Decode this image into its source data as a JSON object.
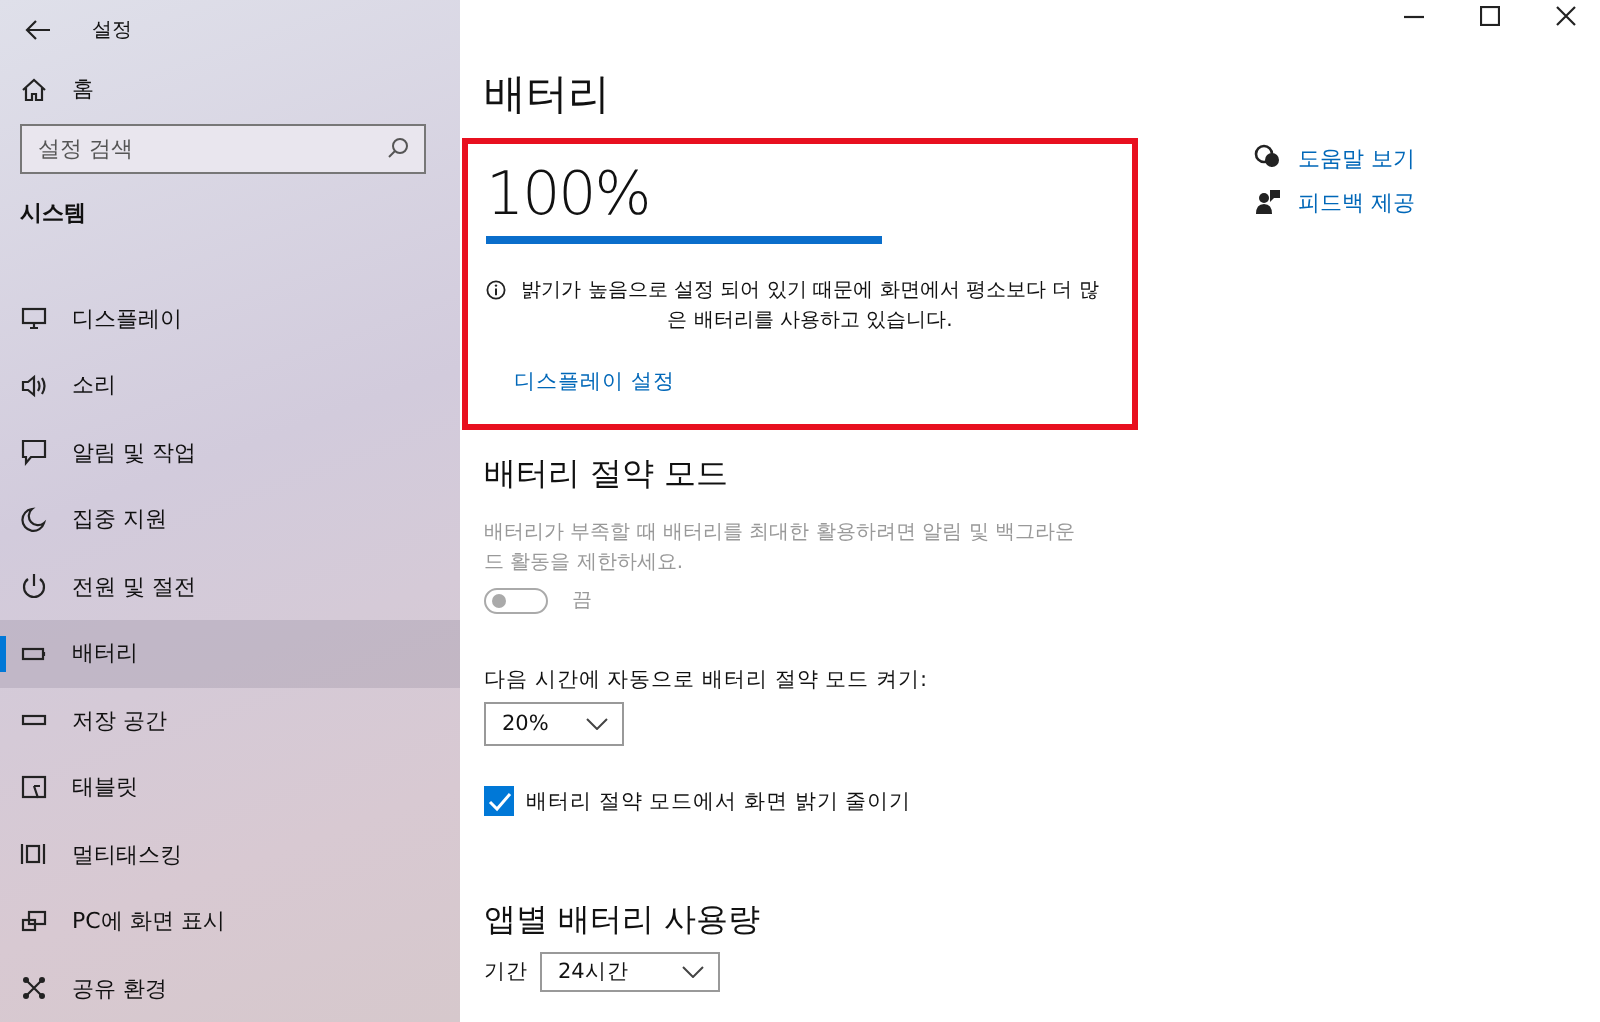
{
  "window": {
    "title": "설정"
  },
  "sidebar": {
    "home": "홈",
    "search": {
      "placeholder": "설정 검색"
    },
    "section": "시스템",
    "items": [
      {
        "label": "디스플레이",
        "selected": false
      },
      {
        "label": "소리",
        "selected": false
      },
      {
        "label": "알림 및 작업",
        "selected": false
      },
      {
        "label": "집중 지원",
        "selected": false
      },
      {
        "label": "전원 및 절전",
        "selected": false
      },
      {
        "label": "배터리",
        "selected": true
      },
      {
        "label": "저장 공간",
        "selected": false
      },
      {
        "label": "태블릿",
        "selected": false
      },
      {
        "label": "멀티태스킹",
        "selected": false
      },
      {
        "label": "PC에 화면 표시",
        "selected": false
      },
      {
        "label": "공유 환경",
        "selected": false
      }
    ]
  },
  "page": {
    "title": "배터리"
  },
  "status": {
    "percent": "100%",
    "level": 1,
    "notice": "밝기가 높음으로 설정 되어 있기 때문에 화면에서 평소보다 더 많은 배터리를 사용하고 있습니다.",
    "link": "디스플레이 설정"
  },
  "saver": {
    "heading": "배터리 절약 모드",
    "description": "배터리가 부족할 때 배터리를 최대한 활용하려면 알림 및 백그라운드 활동을 제한하세요.",
    "disabled": true,
    "toggle": {
      "on": false,
      "label": "끔"
    },
    "threshold_label": "다음 시간에 자동으로 배터리 절약 모드 켜기:",
    "threshold": "20%",
    "dim": {
      "label": "배터리 절약 모드에서 화면 밝기 줄이기",
      "checked": true
    }
  },
  "usage": {
    "heading": "앱별 배터리 사용량",
    "period_label": "기간",
    "period": "24시간"
  },
  "related": [
    {
      "label": "도움말 보기"
    },
    {
      "label": "피드백 제공"
    }
  ]
}
